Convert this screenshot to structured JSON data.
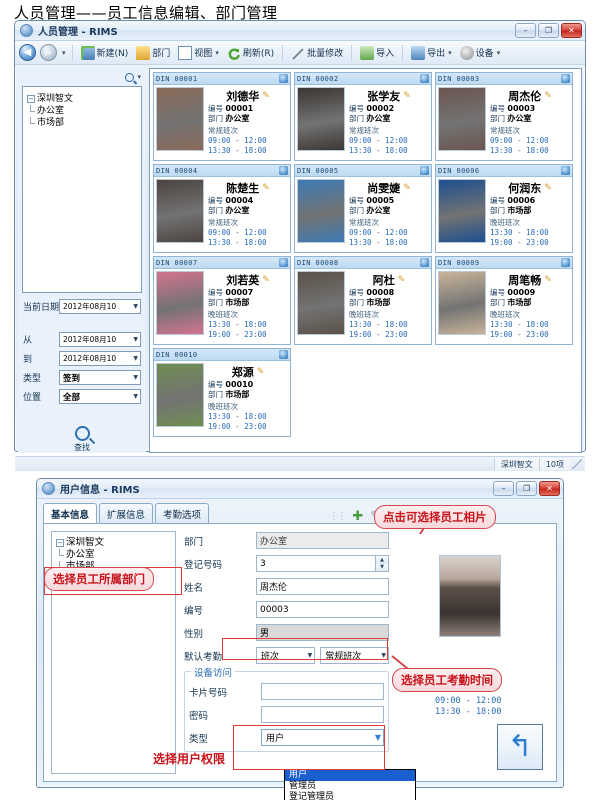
{
  "heading": "人员管理——员工信息编辑、部门管理",
  "main_window": {
    "title": "人员管理 - RIMS",
    "icon": "app-icon",
    "window_buttons": {
      "minimize": "–",
      "maximize": "❐",
      "close": "✕"
    },
    "toolbar": {
      "back_label": "◀",
      "forward_label": "▶",
      "items": [
        {
          "label": "新建(N)",
          "icon": "new-user-icon",
          "caret": false
        },
        {
          "label": "部门",
          "icon": "department-icon",
          "caret": false
        },
        {
          "label": "视图",
          "icon": "view-icon",
          "caret": true
        },
        {
          "label": "刷新(R)",
          "icon": "refresh-icon",
          "caret": false
        },
        {
          "label": "批量修改",
          "icon": "batch-edit-icon",
          "caret": false
        },
        {
          "label": "导入",
          "icon": "import-icon",
          "caret": false
        },
        {
          "label": "导出",
          "icon": "export-icon",
          "caret": true
        },
        {
          "label": "设备",
          "icon": "device-icon",
          "caret": true
        }
      ]
    },
    "left_panel": {
      "search_icon": "search-icon",
      "tree": {
        "root": "深圳智文",
        "children": [
          "办公室",
          "市场部"
        ]
      },
      "fields": [
        {
          "label": "当前日期",
          "value": "2012年08月10"
        },
        {
          "label": "从",
          "value": "2012年08月10"
        },
        {
          "label": "到",
          "value": "2012年08月10"
        },
        {
          "label": "类型",
          "value": "签到"
        },
        {
          "label": "位置",
          "value": "全部"
        }
      ],
      "find_button": {
        "label": "查找",
        "icon": "search-icon"
      }
    },
    "cards": [
      {
        "din": "DIN 00001",
        "name": "刘德华",
        "id_label": "编号",
        "id": "00001",
        "dept_label": "部门",
        "dept": "办公室",
        "shift": "常规班次",
        "time1": "09:00 - 12:00",
        "time2": "13:30 - 18:00",
        "photo": "#8a6a58"
      },
      {
        "din": "DIN 00002",
        "name": "张学友",
        "id_label": "编号",
        "id": "00002",
        "dept_label": "部门",
        "dept": "办公室",
        "shift": "常规班次",
        "time1": "09:00 - 12:00",
        "time2": "13:30 - 18:00",
        "photo": "#3a3632"
      },
      {
        "din": "DIN 00003",
        "name": "周杰伦",
        "id_label": "编号",
        "id": "00003",
        "dept_label": "部门",
        "dept": "办公室",
        "shift": "常规班次",
        "time1": "09:00 - 12:00",
        "time2": "13:30 - 18:00",
        "photo": "#6b5550"
      },
      {
        "din": "DIN 00004",
        "name": "陈楚生",
        "id_label": "编号",
        "id": "00004",
        "dept_label": "部门",
        "dept": "办公室",
        "shift": "常规班次",
        "time1": "09:00 - 12:00",
        "time2": "13:30 - 18:00",
        "photo": "#4b4340"
      },
      {
        "din": "DIN 00005",
        "name": "尚雯婕",
        "id_label": "编号",
        "id": "00005",
        "dept_label": "部门",
        "dept": "办公室",
        "shift": "常规班次",
        "time1": "09:00 - 12:00",
        "time2": "13:30 - 18:00",
        "photo": "#3c7bb5"
      },
      {
        "din": "DIN 00006",
        "name": "何润东",
        "id_label": "编号",
        "id": "00006",
        "dept_label": "部门",
        "dept": "市场部",
        "shift": "晚班班次",
        "time1": "13:30 - 18:00",
        "time2": "19:00 - 23:00",
        "photo": "#1d4f8f"
      },
      {
        "din": "DIN 00007",
        "name": "刘若英",
        "id_label": "编号",
        "id": "00007",
        "dept_label": "部门",
        "dept": "市场部",
        "shift": "晚班班次",
        "time1": "13:30 - 18:00",
        "time2": "19:00 - 23:00",
        "photo": "#d2738f"
      },
      {
        "din": "DIN 00008",
        "name": "阿杜",
        "id_label": "编号",
        "id": "00008",
        "dept_label": "部门",
        "dept": "市场部",
        "shift": "晚班班次",
        "time1": "13:30 - 18:00",
        "time2": "19:00 - 23:00",
        "photo": "#5a5148"
      },
      {
        "din": "DIN 00009",
        "name": "周笔畅",
        "id_label": "编号",
        "id": "00009",
        "dept_label": "部门",
        "dept": "市场部",
        "shift": "晚班班次",
        "time1": "13:30 - 18:00",
        "time2": "19:00 - 23:00",
        "photo": "#c8b49a"
      },
      {
        "din": "DIN 00010",
        "name": "郑源",
        "id_label": "编号",
        "id": "00010",
        "dept_label": "部门",
        "dept": "市场部",
        "shift": "晚班班次",
        "time1": "13:30 - 18:00",
        "time2": "19:00 - 23:00",
        "photo": "#6f8d52"
      }
    ],
    "status_bar": {
      "dept": "深圳智文",
      "count": "10项"
    }
  },
  "dialog": {
    "title": "用户信息 - RIMS",
    "window_buttons": {
      "minimize": "–",
      "maximize": "❐",
      "close": "✕"
    },
    "tabs": [
      {
        "label": "基本信息",
        "active": true
      },
      {
        "label": "扩展信息",
        "active": false
      },
      {
        "label": "考勤选项",
        "active": false
      }
    ],
    "tools": [
      {
        "name": "add",
        "glyph": "✚"
      },
      {
        "name": "edit",
        "glyph": "✎"
      },
      {
        "name": "delete",
        "glyph": "✕"
      },
      {
        "name": "confirm",
        "glyph": "✔"
      },
      {
        "name": "cancel",
        "glyph": "✕"
      }
    ],
    "tree": {
      "root": "深圳智文",
      "children": [
        "办公室",
        "市场部"
      ]
    },
    "fields": [
      {
        "label": "部门",
        "value": "办公室",
        "type": "readonly"
      },
      {
        "label": "登记号码",
        "value": "3",
        "type": "spinner"
      },
      {
        "label": "姓名",
        "value": "周杰伦",
        "type": "text"
      },
      {
        "label": "编号",
        "value": "00003",
        "type": "text"
      },
      {
        "label": "性别",
        "value": "男",
        "type": "grey"
      }
    ],
    "attendance": {
      "label": "默认考勤",
      "select1": "班次",
      "select2": "常规班次",
      "time1": "09:00 - 12:00",
      "time2": "13:30 - 18:00"
    },
    "device_group": {
      "title": "设备访问",
      "card_label": "卡片号码",
      "card_value": "",
      "password_label": "密码",
      "password_value": "",
      "type_label": "类型",
      "type_value": "用户",
      "type_options": [
        "用户",
        "管理员",
        "登记管理员"
      ]
    },
    "back_button": {
      "icon": "back-arrow-icon"
    },
    "annotations": [
      {
        "text": "点击可选择员工相片"
      },
      {
        "text": "选择员工所属部门"
      },
      {
        "text": "选择员工考勤时间"
      },
      {
        "text": "选择用户权限"
      }
    ]
  }
}
